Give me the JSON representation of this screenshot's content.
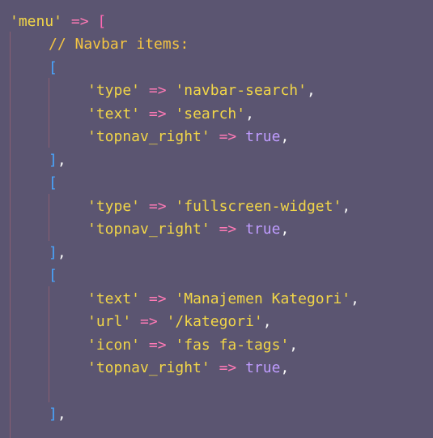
{
  "lines": [
    {
      "indent": 0,
      "tokens": [
        {
          "text": "'menu'",
          "type": "str"
        },
        {
          "text": " ",
          "type": "punct"
        },
        {
          "text": "=>",
          "type": "op"
        },
        {
          "text": " ",
          "type": "punct"
        },
        {
          "text": "[",
          "type": "bracket-outer"
        }
      ]
    },
    {
      "indent": 4,
      "tokens": [
        {
          "text": "// Navbar items:",
          "type": "comment"
        }
      ]
    },
    {
      "indent": 4,
      "tokens": [
        {
          "text": "[",
          "type": "bracket"
        }
      ]
    },
    {
      "indent": 8,
      "tokens": [
        {
          "text": "'type'",
          "type": "str"
        },
        {
          "text": " ",
          "type": "punct"
        },
        {
          "text": "=>",
          "type": "op"
        },
        {
          "text": " ",
          "type": "punct"
        },
        {
          "text": "'navbar-search'",
          "type": "str"
        },
        {
          "text": ",",
          "type": "punct"
        }
      ]
    },
    {
      "indent": 8,
      "tokens": [
        {
          "text": "'text'",
          "type": "str"
        },
        {
          "text": " ",
          "type": "punct"
        },
        {
          "text": "=>",
          "type": "op"
        },
        {
          "text": " ",
          "type": "punct"
        },
        {
          "text": "'search'",
          "type": "str"
        },
        {
          "text": ",",
          "type": "punct"
        }
      ]
    },
    {
      "indent": 8,
      "tokens": [
        {
          "text": "'topnav_right'",
          "type": "str"
        },
        {
          "text": " ",
          "type": "punct"
        },
        {
          "text": "=>",
          "type": "op"
        },
        {
          "text": " ",
          "type": "punct"
        },
        {
          "text": "true",
          "type": "bool"
        },
        {
          "text": ",",
          "type": "punct"
        }
      ]
    },
    {
      "indent": 4,
      "tokens": [
        {
          "text": "]",
          "type": "bracket"
        },
        {
          "text": ",",
          "type": "punct"
        }
      ]
    },
    {
      "indent": 4,
      "tokens": [
        {
          "text": "[",
          "type": "bracket"
        }
      ]
    },
    {
      "indent": 8,
      "tokens": [
        {
          "text": "'type'",
          "type": "str"
        },
        {
          "text": " ",
          "type": "punct"
        },
        {
          "text": "=>",
          "type": "op"
        },
        {
          "text": " ",
          "type": "punct"
        },
        {
          "text": "'fullscreen-widget'",
          "type": "str"
        },
        {
          "text": ",",
          "type": "punct"
        }
      ]
    },
    {
      "indent": 8,
      "tokens": [
        {
          "text": "'topnav_right'",
          "type": "str"
        },
        {
          "text": " ",
          "type": "punct"
        },
        {
          "text": "=>",
          "type": "op"
        },
        {
          "text": " ",
          "type": "punct"
        },
        {
          "text": "true",
          "type": "bool"
        },
        {
          "text": ",",
          "type": "punct"
        }
      ]
    },
    {
      "indent": 4,
      "tokens": [
        {
          "text": "]",
          "type": "bracket"
        },
        {
          "text": ",",
          "type": "punct"
        }
      ]
    },
    {
      "indent": 4,
      "tokens": [
        {
          "text": "[",
          "type": "bracket"
        }
      ]
    },
    {
      "indent": 8,
      "tokens": [
        {
          "text": "'text'",
          "type": "str"
        },
        {
          "text": " ",
          "type": "punct"
        },
        {
          "text": "=>",
          "type": "op"
        },
        {
          "text": " ",
          "type": "punct"
        },
        {
          "text": "'Manajemen Kategori'",
          "type": "str"
        },
        {
          "text": ",",
          "type": "punct"
        }
      ]
    },
    {
      "indent": 8,
      "tokens": [
        {
          "text": "'url'",
          "type": "str"
        },
        {
          "text": " ",
          "type": "punct"
        },
        {
          "text": "=>",
          "type": "op"
        },
        {
          "text": " ",
          "type": "punct"
        },
        {
          "text": "'/kategori'",
          "type": "str"
        },
        {
          "text": ",",
          "type": "punct"
        }
      ]
    },
    {
      "indent": 8,
      "tokens": [
        {
          "text": "'icon'",
          "type": "str"
        },
        {
          "text": " ",
          "type": "punct"
        },
        {
          "text": "=>",
          "type": "op"
        },
        {
          "text": " ",
          "type": "punct"
        },
        {
          "text": "'fas fa-tags'",
          "type": "str"
        },
        {
          "text": ",",
          "type": "punct"
        }
      ]
    },
    {
      "indent": 8,
      "tokens": [
        {
          "text": "'topnav_right'",
          "type": "str"
        },
        {
          "text": " ",
          "type": "punct"
        },
        {
          "text": "=>",
          "type": "op"
        },
        {
          "text": " ",
          "type": "punct"
        },
        {
          "text": "true",
          "type": "bool"
        },
        {
          "text": ",",
          "type": "punct"
        }
      ]
    },
    {
      "indent": 0,
      "tokens": []
    },
    {
      "indent": 4,
      "tokens": [
        {
          "text": "]",
          "type": "bracket"
        },
        {
          "text": ",",
          "type": "punct"
        }
      ]
    }
  ],
  "colors": {
    "background": "#5b5571",
    "string": "#f2d648",
    "operator": "#ff7ab6",
    "punctuation": "#f7f7f7",
    "bracket": "#49a6ff",
    "outer_bracket": "#ff69b4",
    "comment": "#f5c542",
    "boolean": "#bf9cff",
    "indent_guide": "#8a5f72"
  }
}
